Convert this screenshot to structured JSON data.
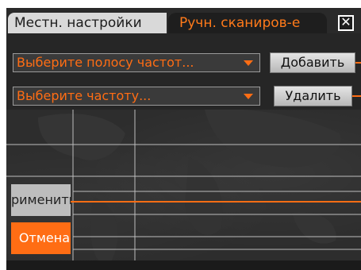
{
  "tabs": {
    "local_settings": "Местн. настройки",
    "manual_scan": "Ручн. сканиров-е"
  },
  "close_icon": "close-icon",
  "controls": {
    "band_select_placeholder": "Выберите полосу частот...",
    "frequency_select_placeholder": "Выберите частоту...",
    "add_label": "Добавить",
    "delete_label": "Удалить"
  },
  "actions": {
    "apply_label": "рименить",
    "cancel_label": "Отмена"
  },
  "colors": {
    "accent": "#ff6d14",
    "background": "#2d2d2d",
    "tab_inactive": "#d9d9d9"
  }
}
